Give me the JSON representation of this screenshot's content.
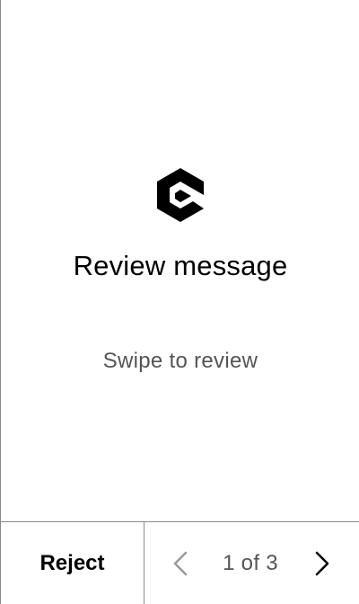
{
  "review": {
    "logo_icon": "app-logo-icon",
    "title": "Review message",
    "subtitle": "Swipe to review"
  },
  "footer": {
    "reject_label": "Reject",
    "page_indicator": "1 of 3",
    "prev_icon": "chevron-left-icon",
    "next_icon": "chevron-right-icon",
    "prev_color": "#9a9a9a",
    "next_color": "#000000"
  }
}
